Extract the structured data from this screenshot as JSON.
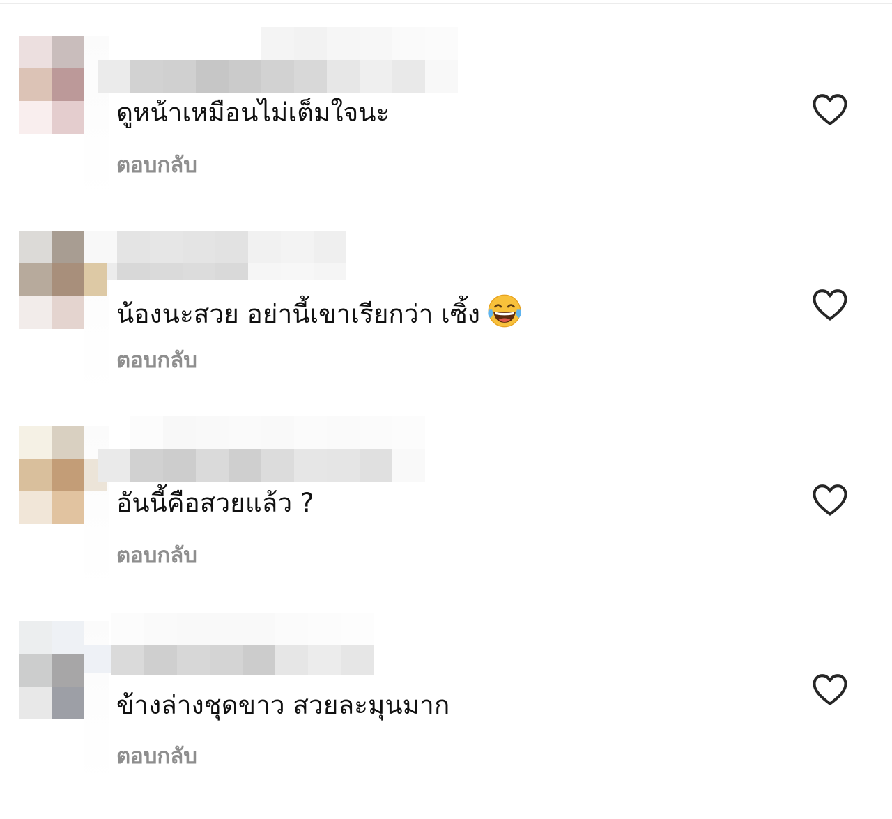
{
  "comments": [
    {
      "text": "ดูหน้าเหมือนไม่เต็มใจนะ",
      "reply_label": "ตอบกลับ",
      "like_icon": "heart-outline-icon",
      "avatar_colors": [
        "#ecdfdf",
        "#c9bdbc",
        "#dcc3b6",
        "#bc9999",
        "#f9eeee",
        "#e4cdce"
      ]
    },
    {
      "text": "น้องนะสวย อย่านี้เขาเรียกว่า เซิ้ง",
      "emoji": "face-with-tears-of-joy-icon",
      "reply_label": "ตอบกลับ",
      "like_icon": "heart-outline-icon",
      "avatar_colors": [
        "#dcdad7",
        "#a89d92",
        "#b7aa9c",
        "#a88f7b",
        "#f2ecea",
        "#e4d4cf"
      ]
    },
    {
      "text": "อันนี้คือสวยแล้ว ?",
      "reply_label": "ตอบกลับ",
      "like_icon": "heart-outline-icon",
      "avatar_colors": [
        "#f5f1e5",
        "#d9d0c1",
        "#d9bf9c",
        "#c39d77",
        "#f1e6d8",
        "#e1c3a0"
      ]
    },
    {
      "text": "ข้างล่างชุดขาว สวยละมุนมาก",
      "reply_label": "ตอบกลับ",
      "like_icon": "heart-outline-icon",
      "avatar_colors": [
        "#eceeef",
        "#eef1f5",
        "#cccdcd",
        "#a7a6a7",
        "#e8e8e8",
        "#9d9fa6"
      ]
    }
  ],
  "colors": {
    "text_primary": "#111111",
    "text_secondary": "#8e8e8e",
    "heart_stroke": "#262626",
    "background": "#ffffff"
  }
}
